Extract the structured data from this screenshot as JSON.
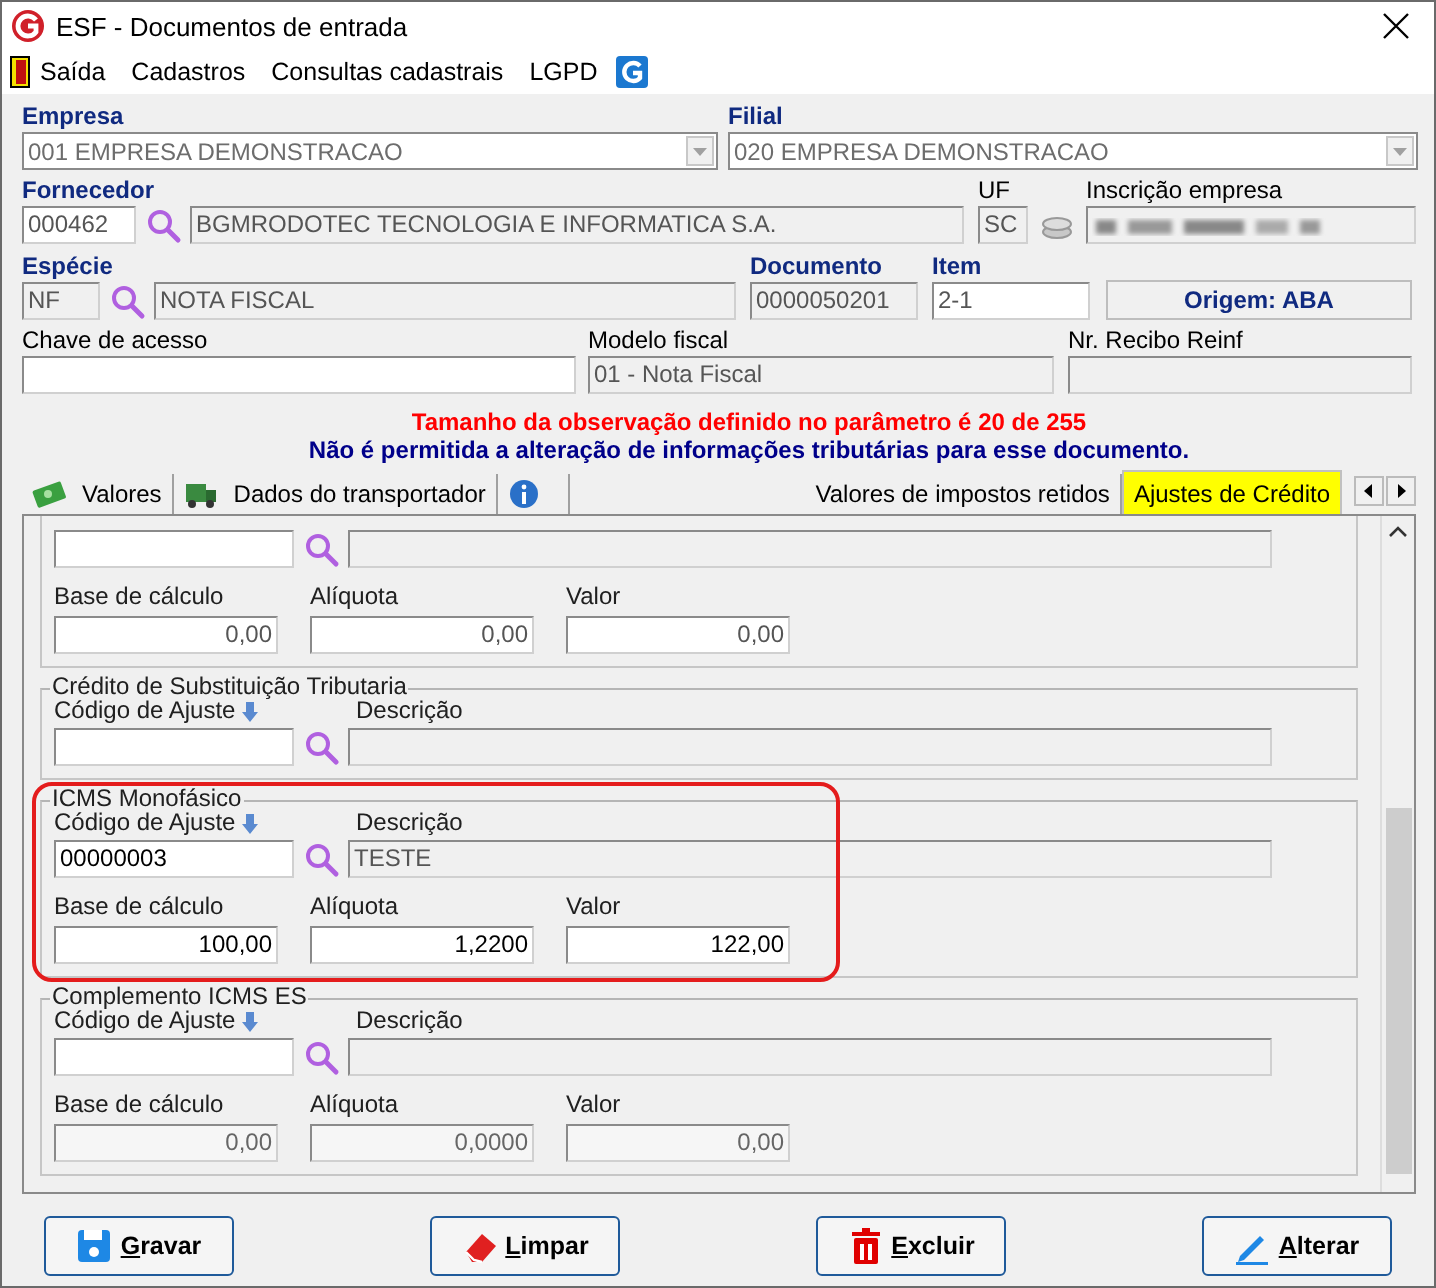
{
  "window": {
    "title": "ESF - Documentos de entrada"
  },
  "menu": [
    {
      "label": "Saída"
    },
    {
      "label": "Cadastros"
    },
    {
      "label": "Consultas cadastrais"
    },
    {
      "label": "LGPD"
    }
  ],
  "empresa": {
    "label": "Empresa",
    "value": "001 EMPRESA DEMONSTRACAO"
  },
  "filial": {
    "label": "Filial",
    "value": "020 EMPRESA DEMONSTRACAO"
  },
  "fornecedor": {
    "label": "Fornecedor",
    "code": "000462",
    "name": "BGMRODOTEC TECNOLOGIA E INFORMATICA S.A."
  },
  "uf": {
    "label": "UF",
    "value": "SC"
  },
  "inscricao_empresa": {
    "label": "Inscrição empresa"
  },
  "especie": {
    "label": "Espécie",
    "code": "NF",
    "name": "NOTA FISCAL"
  },
  "documento": {
    "label": "Documento",
    "value": "0000050201"
  },
  "item": {
    "label": "Item",
    "value": "2-1"
  },
  "origem": "Origem: ABA",
  "chave_de_acesso": {
    "label": "Chave de acesso"
  },
  "modelo_fiscal": {
    "label": "Modelo fiscal",
    "value": "01 - Nota Fiscal"
  },
  "nr_recibo_reinf": {
    "label": "Nr. Recibo Reinf"
  },
  "messages": [
    {
      "kind": "warning",
      "text": "Tamanho da observação definido no parâmetro é 20 de 255"
    },
    {
      "kind": "info",
      "text": "Não é permitida a alteração de informações tributárias para esse documento."
    }
  ],
  "tabs": [
    {
      "label": "Valores",
      "selected": false
    },
    {
      "label": "Dados do transportador",
      "selected": false
    },
    {
      "selected": false
    },
    {
      "label": "Valores de impostos retidos",
      "selected": false
    },
    {
      "label": "Ajustes de Crédito",
      "selected": true
    }
  ],
  "groups": [
    {
      "highlighted": false,
      "disabled": false,
      "amounts": [
        {
          "label": "Base de cálculo",
          "value": "0,00"
        },
        {
          "label": "Alíquota",
          "value": "0,00"
        },
        {
          "label": "Valor",
          "value": "0,00"
        }
      ]
    },
    {
      "legend": "Crédito de Substituição Tributaria",
      "code_label": "Código de Ajuste",
      "description_label": "Descrição",
      "highlighted": false,
      "disabled": false
    },
    {
      "legend": "ICMS Monofásico",
      "code_label": "Código de Ajuste",
      "code": "00000003",
      "description_label": "Descrição",
      "description": "TESTE",
      "highlighted": true,
      "disabled": false,
      "amounts": [
        {
          "label": "Base de cálculo",
          "value": "100,00"
        },
        {
          "label": "Alíquota",
          "value": "1,2200"
        },
        {
          "label": "Valor",
          "value": "122,00"
        }
      ]
    },
    {
      "legend": "Complemento ICMS ES",
      "code_label": "Código de Ajuste",
      "description_label": "Descrição",
      "highlighted": false,
      "disabled": true,
      "amounts": [
        {
          "label": "Base de cálculo",
          "value": "0,00"
        },
        {
          "label": "Alíquota",
          "value": "0,0000"
        },
        {
          "label": "Valor",
          "value": "0,00"
        }
      ]
    }
  ],
  "buttons": [
    {
      "label": "Gravar"
    },
    {
      "label": "Limpar"
    },
    {
      "label": "Excluir"
    },
    {
      "label": "Alterar"
    }
  ]
}
